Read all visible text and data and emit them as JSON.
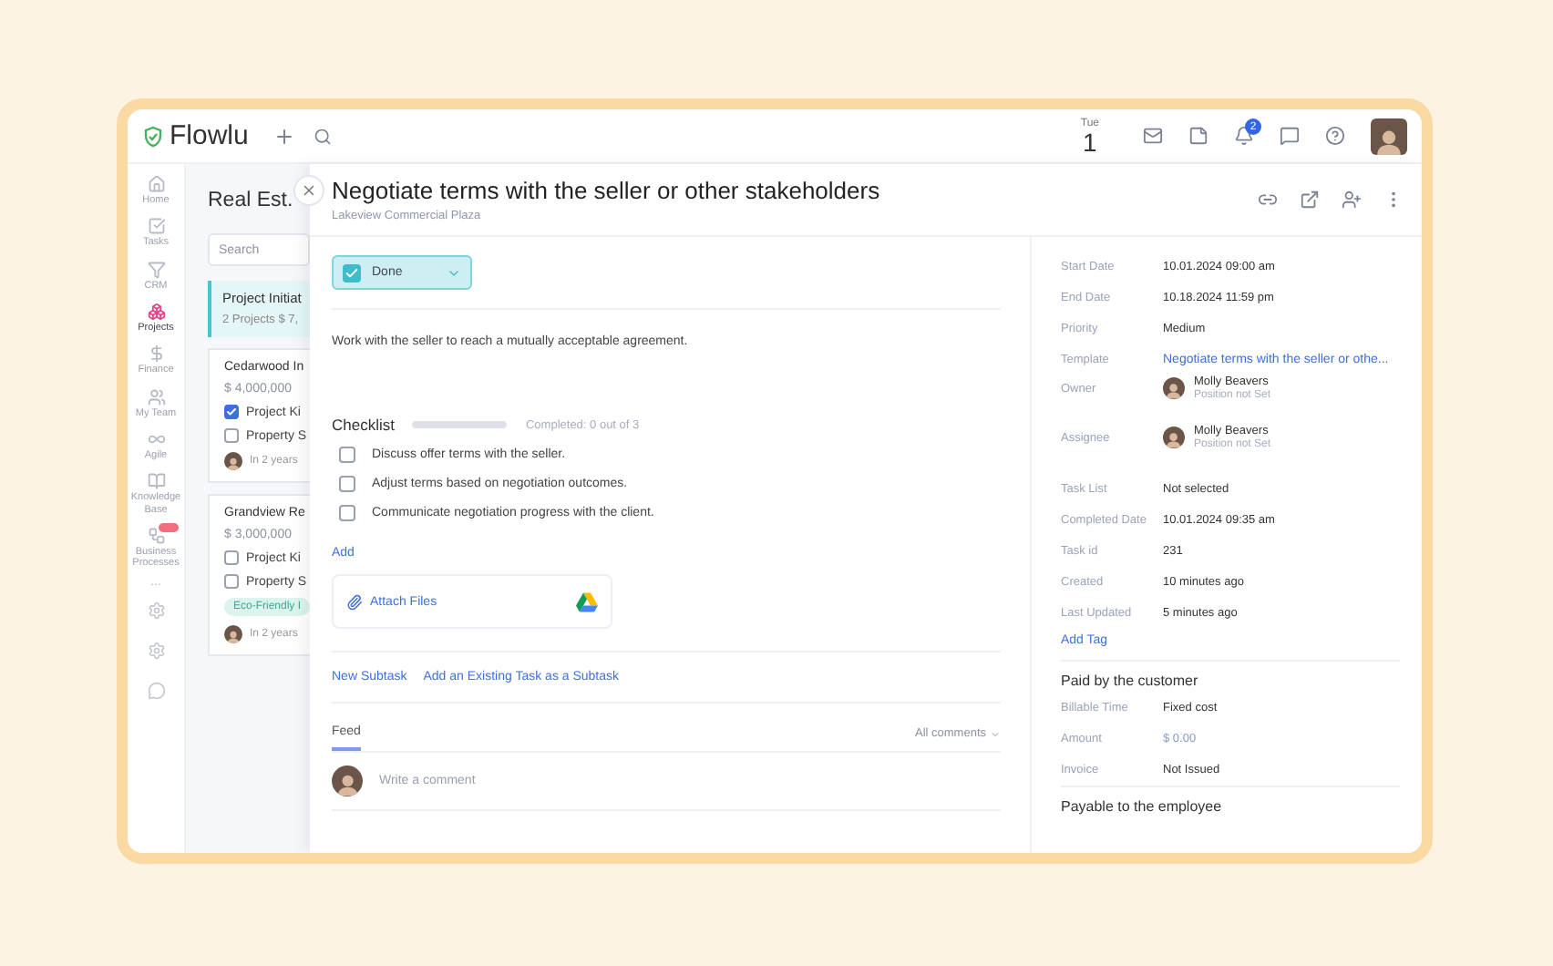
{
  "app": {
    "logo": "Flowlu",
    "date": {
      "weekday": "Tue",
      "day": "1"
    },
    "notifications": "2"
  },
  "nav": [
    {
      "label": "Home",
      "selected": false
    },
    {
      "label": "Tasks",
      "selected": false
    },
    {
      "label": "CRM",
      "selected": false
    },
    {
      "label": "Projects",
      "selected": true
    },
    {
      "label": "Finance",
      "selected": false
    },
    {
      "label": "My Team",
      "selected": false
    },
    {
      "label": "Agile",
      "selected": false
    },
    {
      "label": "Knowledge Base",
      "selected": false
    },
    {
      "label": "Business Processes",
      "selected": false
    }
  ],
  "nav_more": "...",
  "projects": {
    "title": "Real Est.",
    "search": {
      "placeholder": "Search"
    },
    "stage": {
      "name": "Project Initiat",
      "count": "2 Projects",
      "amount": "$ 7,"
    },
    "cards": [
      {
        "name": "Cedarwood In",
        "amount": "$ 4,000,000",
        "items": [
          {
            "label": "Project Ki",
            "checked": true
          },
          {
            "label": "Property S",
            "checked": false
          }
        ],
        "due": "In 2 years"
      },
      {
        "name": "Grandview Re",
        "amount": "$ 3,000,000",
        "items": [
          {
            "label": "Project Ki",
            "checked": false
          },
          {
            "label": "Property S",
            "checked": false
          }
        ],
        "tag": "Eco-Friendly I",
        "due": "In 2 years"
      }
    ]
  },
  "task": {
    "title": "Negotiate terms with the seller or other stakeholders",
    "project": "Lakeview Commercial Plaza",
    "status": {
      "label": "Done",
      "checked": true
    },
    "description": "Work with the seller to reach a mutually acceptable agreement.",
    "checklist": {
      "title": "Checklist",
      "level": 0,
      "progress": "Completed: 0 out of 3",
      "items": [
        {
          "label": "Discuss offer terms with the seller.",
          "checked": false
        },
        {
          "label": "Adjust terms based on negotiation outcomes.",
          "checked": false
        },
        {
          "label": "Communicate negotiation progress with the client.",
          "checked": false
        }
      ],
      "add": "Add"
    },
    "attach": "Attach Files",
    "subtask_links": [
      "New Subtask",
      "Add an Existing Task as a Subtask"
    ],
    "tabs": [
      {
        "label": "Feed",
        "selected": true
      }
    ],
    "all_comments": "All comments",
    "comment": {
      "placeholder": "Write a comment"
    }
  },
  "details": [
    {
      "label": "Start Date",
      "kind": "text",
      "value": "10.01.2024 09:00 am"
    },
    {
      "label": "End Date",
      "kind": "text",
      "value": "10.18.2024 11:59 pm"
    },
    {
      "label": "Priority",
      "kind": "text",
      "value": "Medium"
    },
    {
      "label": "Template",
      "kind": "link",
      "value": "Negotiate terms with the seller or othe..."
    },
    {
      "label": "Owner",
      "kind": "person",
      "value": "Molly Beavers",
      "position": "Position not Set"
    },
    {
      "label": "Assignee",
      "kind": "person",
      "value": "Molly Beavers",
      "position": "Position not Set"
    },
    {
      "label": "Task List",
      "kind": "text",
      "value": "Not selected"
    },
    {
      "label": "Completed Date",
      "kind": "text",
      "value": "10.01.2024 09:35 am"
    },
    {
      "label": "Task id",
      "kind": "text",
      "value": "231"
    },
    {
      "label": "Created",
      "kind": "text",
      "value": "10 minutes ago"
    },
    {
      "label": "Last Updated",
      "kind": "text",
      "value": "5 minutes ago"
    }
  ],
  "add_tag": "Add Tag",
  "sections": [
    {
      "title": "Paid by the customer",
      "rows": [
        {
          "label": "Billable Time",
          "kind": "text",
          "value": "Fixed cost"
        },
        {
          "label": "Amount",
          "kind": "muted",
          "value": "$ 0.00"
        },
        {
          "label": "Invoice",
          "kind": "text",
          "value": "Not Issued"
        }
      ]
    },
    {
      "title": "Payable to the employee"
    }
  ]
}
